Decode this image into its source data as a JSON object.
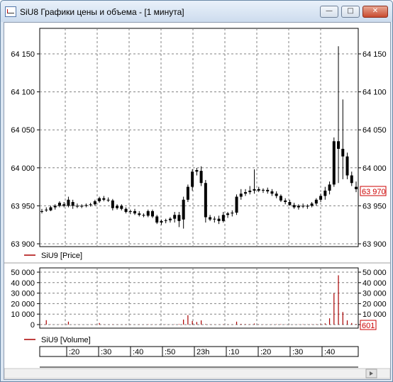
{
  "window": {
    "title": "SiU8 Графики цены и объема - [1 минута]",
    "minimize_glyph": "—",
    "maximize_glyph": "□",
    "close_glyph": "✕"
  },
  "price_panel": {
    "legend_label": "SiU9 [Price]",
    "y_ticks": [
      "64 150",
      "64 100",
      "64 050",
      "64 000",
      "63 950",
      "63 900"
    ],
    "last_value": "63 970",
    "last_value_color": "#cc0000"
  },
  "volume_panel": {
    "legend_label": "SiU9 [Volume]",
    "y_ticks": [
      "50 000",
      "40 000",
      "30 000",
      "20 000",
      "10 000",
      "0"
    ],
    "last_value": "601",
    "bar_color": "#aa0000"
  },
  "time_axis": {
    "labels": [
      ":20",
      ":30",
      ":40",
      ":50",
      "23h",
      ":10",
      ":20",
      ":30",
      ":40"
    ]
  },
  "chart_data": [
    {
      "type": "candlestick",
      "series": [
        {
          "name": "SiU9 [Price]",
          "values": [
            [
              63943,
              63946,
              63940,
              63942
            ],
            [
              63945,
              63948,
              63942,
              63944
            ],
            [
              63944,
              63950,
              63943,
              63948
            ],
            [
              63948,
              63952,
              63945,
              63950
            ],
            [
              63950,
              63956,
              63948,
              63954
            ],
            [
              63952,
              63955,
              63948,
              63950
            ],
            [
              63950,
              63962,
              63948,
              63958
            ],
            [
              63955,
              63958,
              63946,
              63950
            ],
            [
              63950,
              63953,
              63947,
              63949
            ],
            [
              63949,
              63952,
              63947,
              63950
            ],
            [
              63950,
              63953,
              63948,
              63951
            ],
            [
              63951,
              63954,
              63949,
              63952
            ],
            [
              63952,
              63958,
              63950,
              63956
            ],
            [
              63956,
              63962,
              63954,
              63960
            ],
            [
              63960,
              63963,
              63956,
              63958
            ],
            [
              63958,
              63961,
              63955,
              63957
            ],
            [
              63957,
              63959,
              63944,
              63947
            ],
            [
              63947,
              63952,
              63945,
              63950
            ],
            [
              63950,
              63952,
              63944,
              63946
            ],
            [
              63946,
              63948,
              63940,
              63942
            ],
            [
              63942,
              63945,
              63939,
              63943
            ],
            [
              63943,
              63946,
              63938,
              63940
            ],
            [
              63940,
              63943,
              63936,
              63938
            ],
            [
              63938,
              63940,
              63935,
              63937
            ],
            [
              63937,
              63945,
              63935,
              63943
            ],
            [
              63943,
              63945,
              63934,
              63936
            ],
            [
              63936,
              63938,
              63926,
              63928
            ],
            [
              63928,
              63932,
              63925,
              63930
            ],
            [
              63930,
              63933,
              63927,
              63931
            ],
            [
              63931,
              63935,
              63928,
              63933
            ],
            [
              63933,
              63942,
              63928,
              63938
            ],
            [
              63938,
              63942,
              63922,
              63930
            ],
            [
              63932,
              63962,
              63920,
              63958
            ],
            [
              63958,
              63978,
              63955,
              63975
            ],
            [
              63975,
              63998,
              63970,
              63995
            ],
            [
              63995,
              64000,
              63990,
              63997
            ],
            [
              63996,
              64002,
              63976,
              63980
            ],
            [
              63980,
              63984,
              63928,
              63935
            ],
            [
              63935,
              63938,
              63930,
              63932
            ],
            [
              63932,
              63936,
              63928,
              63933
            ],
            [
              63933,
              63937,
              63926,
              63930
            ],
            [
              63930,
              63942,
              63928,
              63938
            ],
            [
              63938,
              63942,
              63934,
              63940
            ],
            [
              63940,
              63944,
              63936,
              63941
            ],
            [
              63941,
              63965,
              63938,
              63962
            ],
            [
              63962,
              63972,
              63958,
              63966
            ],
            [
              63966,
              63972,
              63963,
              63968
            ],
            [
              63968,
              63976,
              63965,
              63970
            ],
            [
              63970,
              63998,
              63966,
              63972
            ],
            [
              63972,
              63975,
              63968,
              63970
            ],
            [
              63970,
              63973,
              63967,
              63971
            ],
            [
              63971,
              63974,
              63966,
              63969
            ],
            [
              63969,
              63972,
              63963,
              63966
            ],
            [
              63966,
              63969,
              63960,
              63963
            ],
            [
              63963,
              63965,
              63955,
              63957
            ],
            [
              63957,
              63960,
              63952,
              63955
            ],
            [
              63955,
              63958,
              63950,
              63951
            ],
            [
              63951,
              63954,
              63946,
              63948
            ],
            [
              63948,
              63952,
              63945,
              63950
            ],
            [
              63950,
              63953,
              63947,
              63949
            ],
            [
              63949,
              63952,
              63946,
              63950
            ],
            [
              63950,
              63955,
              63948,
              63953
            ],
            [
              63953,
              63960,
              63950,
              63958
            ],
            [
              63958,
              63966,
              63955,
              63963
            ],
            [
              63963,
              63975,
              63958,
              63970
            ],
            [
              63970,
              63982,
              63965,
              63978
            ],
            [
              63978,
              64040,
              63975,
              64035
            ],
            [
              64035,
              64160,
              63980,
              64025
            ],
            [
              64025,
              64090,
              63985,
              64015
            ],
            [
              64015,
              64020,
              63985,
              63990
            ],
            [
              63990,
              63995,
              63976,
              63980
            ],
            [
              63975,
              63982,
              63968,
              63972
            ]
          ]
        }
      ],
      "ylim": [
        63900,
        64170
      ]
    },
    {
      "type": "bar",
      "series": [
        {
          "name": "SiU9 [Volume]",
          "values": [
            300,
            4200,
            200,
            100,
            150,
            200,
            2800,
            100,
            150,
            100,
            100,
            150,
            200,
            1500,
            200,
            100,
            300,
            150,
            100,
            200,
            150,
            100,
            200,
            150,
            300,
            200,
            150,
            100,
            200,
            150,
            300,
            500,
            4800,
            9000,
            3500,
            2500,
            4000,
            500,
            300,
            200,
            150,
            300,
            200,
            150,
            2800,
            700,
            500,
            400,
            1000,
            300,
            200,
            150,
            200,
            300,
            400,
            250,
            200,
            150,
            200,
            300,
            200,
            300,
            400,
            600,
            1200,
            6000,
            30000,
            47000,
            12000,
            4000,
            1500,
            601
          ]
        }
      ],
      "ylim": [
        0,
        52000
      ]
    }
  ]
}
